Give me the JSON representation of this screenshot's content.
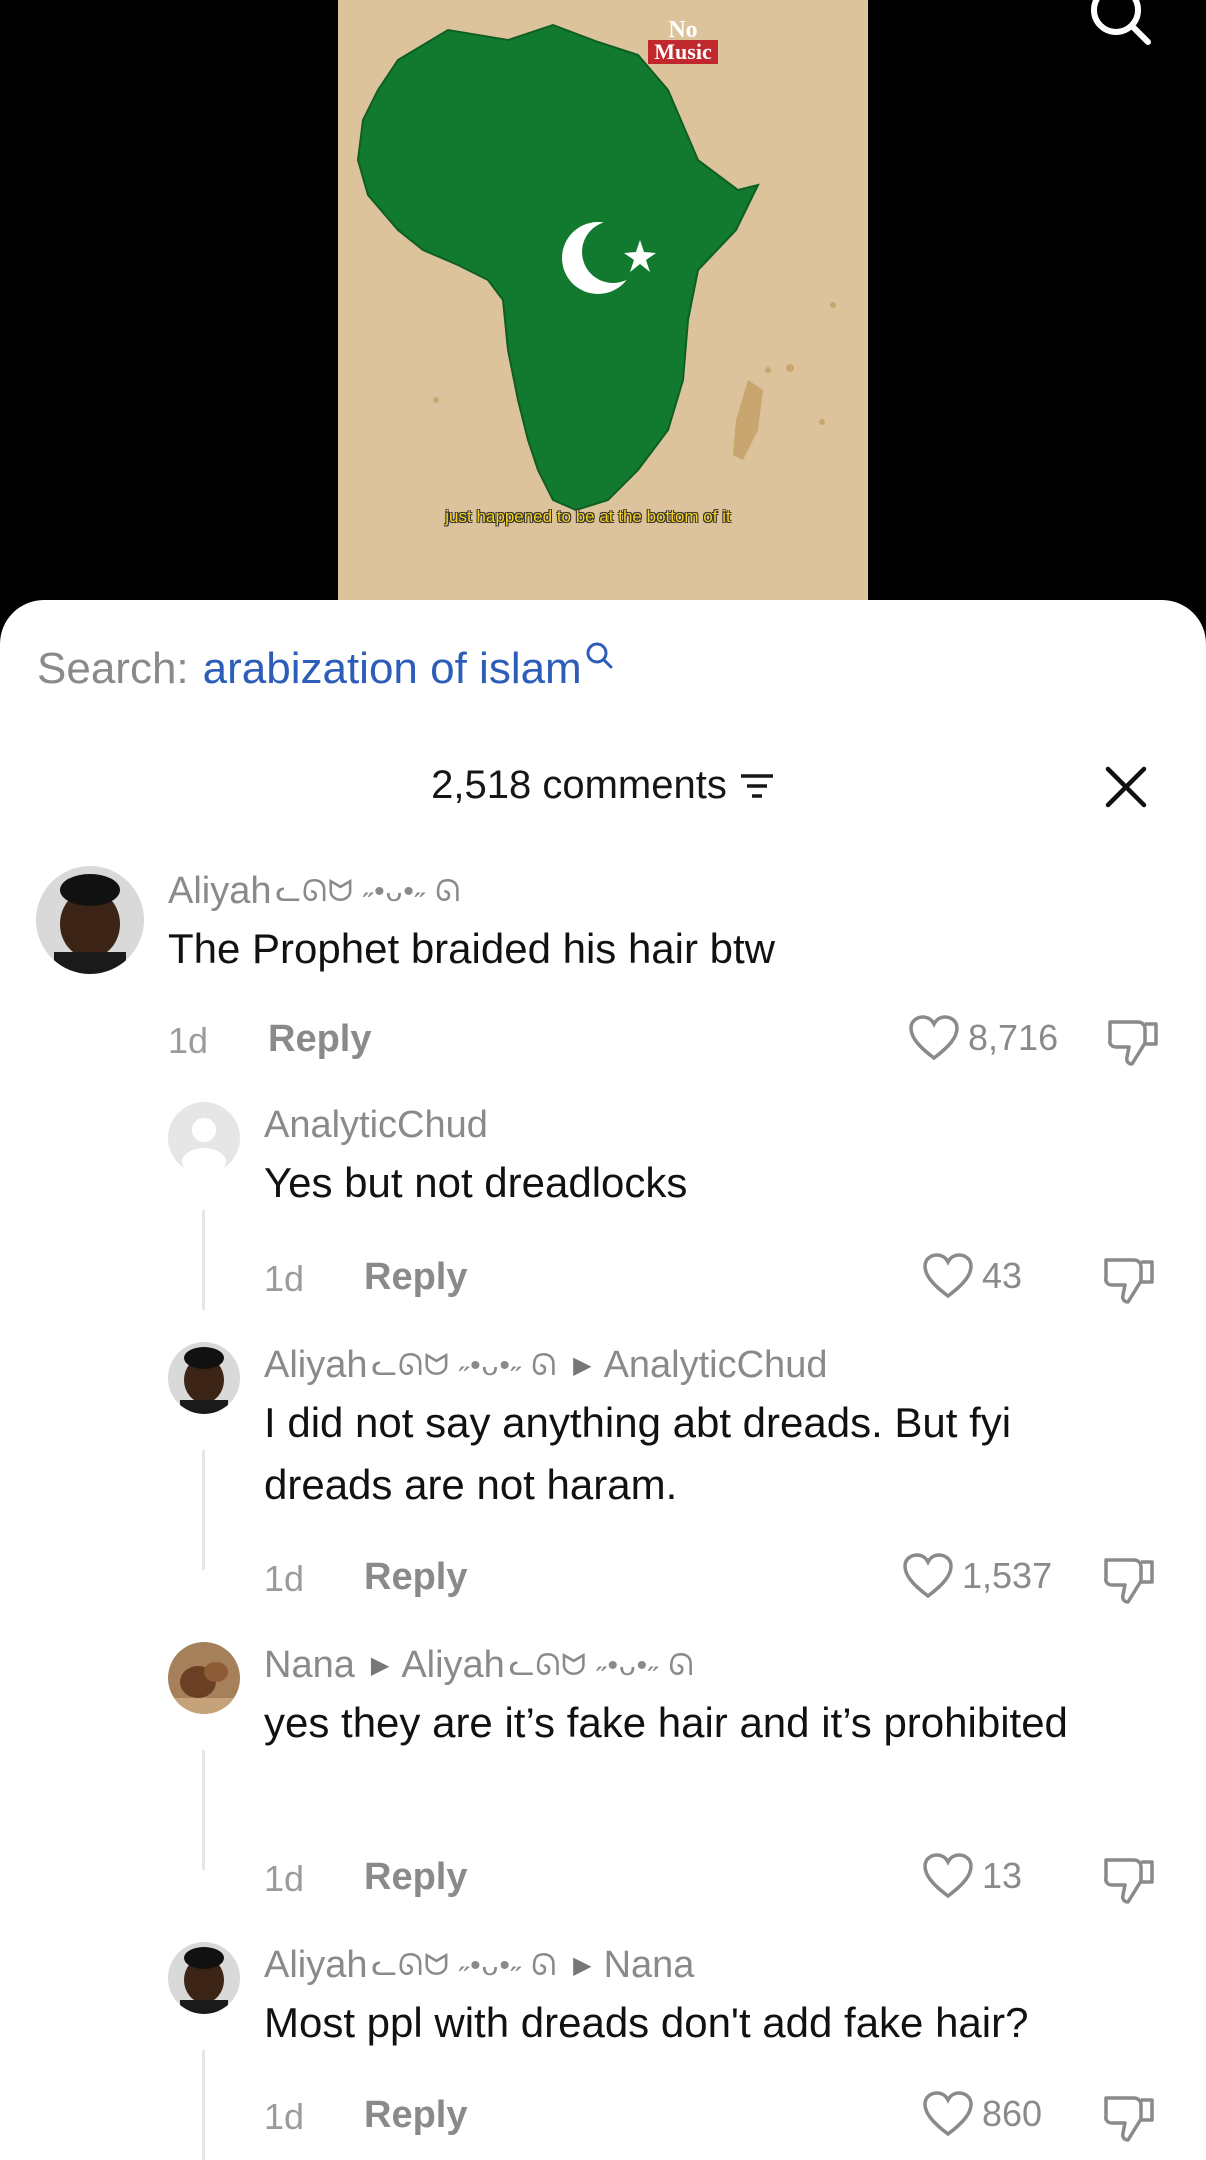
{
  "video": {
    "watermark_line1": "No",
    "watermark_line2": "Music",
    "caption": "just happened to be at the bottom of it"
  },
  "search": {
    "prefix": "Search:",
    "query": "arabization of islam"
  },
  "comments_header": {
    "count_label": "2,518 comments"
  },
  "comments": [
    {
      "user": "Aliyah",
      "decor": "ᓚᘏᗢ ˶•ᴗ•˶ ᘏ",
      "text": "The Prophet braided his hair btw",
      "age": "1d",
      "reply": "Reply",
      "likes": "8,716"
    },
    {
      "user": "AnalyticChud",
      "text": "Yes but not dreadlocks",
      "age": "1d",
      "reply": "Reply",
      "likes": "43"
    },
    {
      "user": "Aliyah",
      "decor": "ᓚᘏᗢ ˶•ᴗ•˶ ᘏ",
      "reply_to": "AnalyticChud",
      "text": "I did not say anything abt dreads. But fyi dreads are not haram.",
      "age": "1d",
      "reply": "Reply",
      "likes": "1,537"
    },
    {
      "user": "Nana",
      "reply_to": "Aliyah",
      "reply_to_decor": "ᓚᘏᗢ ˶•ᴗ•˶ ᘏ",
      "text": "yes they are it’s fake hair and it’s prohibited",
      "age": "1d",
      "reply": "Reply",
      "likes": "13"
    },
    {
      "user": "Aliyah",
      "decor": "ᓚᘏᗢ ˶•ᴗ•˶ ᘏ",
      "reply_to": "Nana",
      "text": "Most ppl with dreads don't add fake hair?",
      "age": "1d",
      "reply": "Reply",
      "likes": "860"
    }
  ],
  "colors": {
    "sheet_bg": "#ffffff",
    "query_blue": "#2c5db8",
    "map_green": "#127a2e",
    "map_bg": "#dcc39c"
  }
}
